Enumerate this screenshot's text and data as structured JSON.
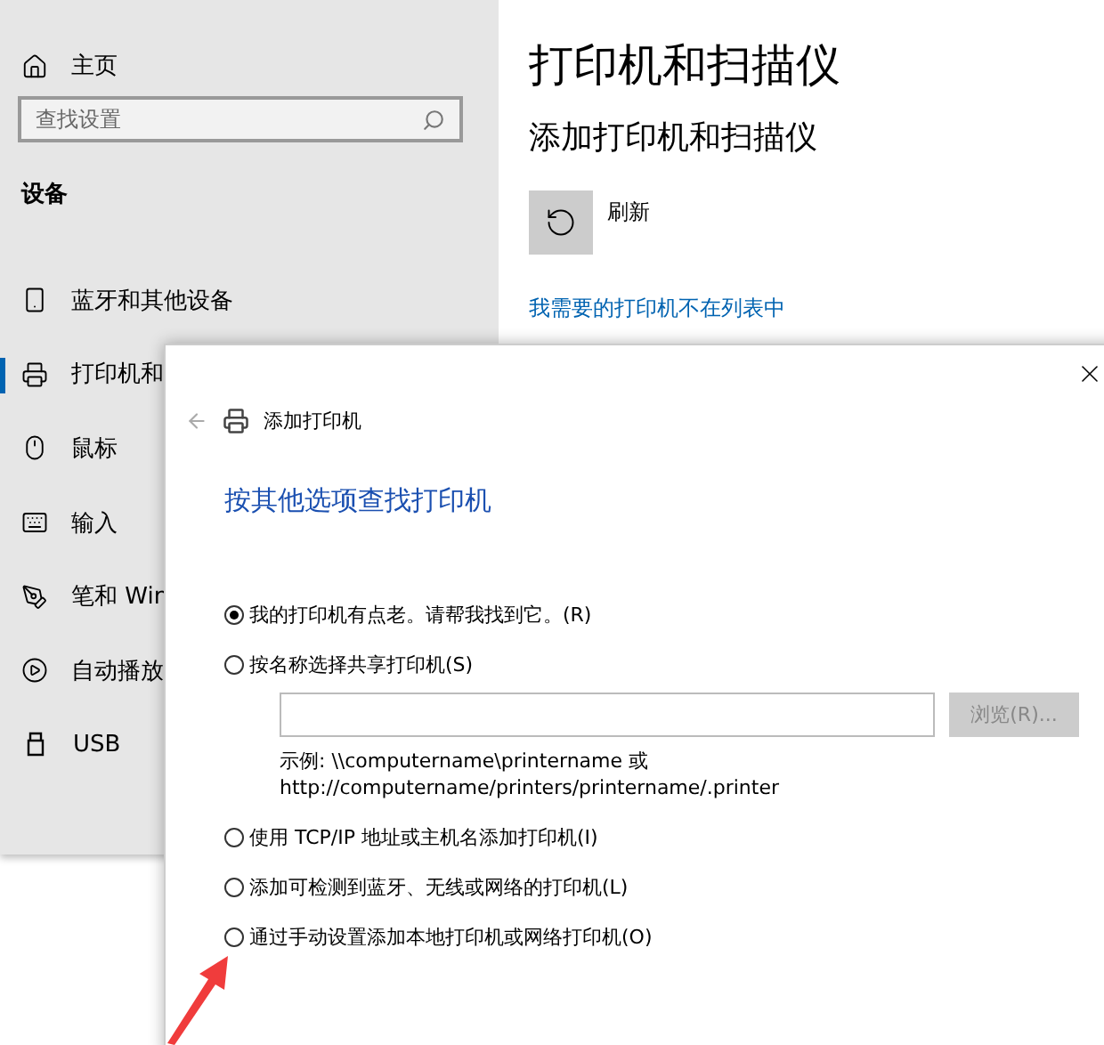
{
  "settings": {
    "sidebar": {
      "home": "主页",
      "search": {
        "placeholder": "查找设置"
      },
      "section": "设备",
      "items": [
        {
          "label": "蓝牙和其他设备",
          "selected": false
        },
        {
          "label": "打印机和",
          "selected": true
        },
        {
          "label": "鼠标",
          "selected": false
        },
        {
          "label": "输入",
          "selected": false
        },
        {
          "label": "笔和 Win",
          "selected": false
        },
        {
          "label": "自动播放",
          "selected": false
        },
        {
          "label": "USB",
          "selected": false
        }
      ]
    },
    "content": {
      "title": "打印机和扫描仪",
      "subtitle": "添加打印机和扫描仪",
      "refresh": "刷新",
      "link": "我需要的打印机不在列表中"
    }
  },
  "dialog": {
    "title": "添加打印机",
    "heading": "按其他选项查找打印机",
    "options": [
      {
        "kind": "radio",
        "label": "我的打印机有点老。请帮我找到它。(R)",
        "selected": true
      },
      {
        "kind": "path",
        "label": "按名称选择共享打印机(S)",
        "selected": false,
        "browse": {
          "label": "浏览(R)...",
          "disabled": true
        },
        "hint": [
          "示例: \\\\computername\\printername 或",
          "http://computername/printers/printername/.printer"
        ]
      },
      {
        "kind": "radio",
        "label": "使用 TCP/IP 地址或主机名添加打印机(I)",
        "selected": false
      },
      {
        "kind": "radio",
        "label": "添加可检测到蓝牙、无线或网络的打印机(L)",
        "selected": false
      },
      {
        "kind": "radio",
        "label": "通过手动设置添加本地打印机或网络打印机(O)",
        "selected": false
      }
    ]
  }
}
